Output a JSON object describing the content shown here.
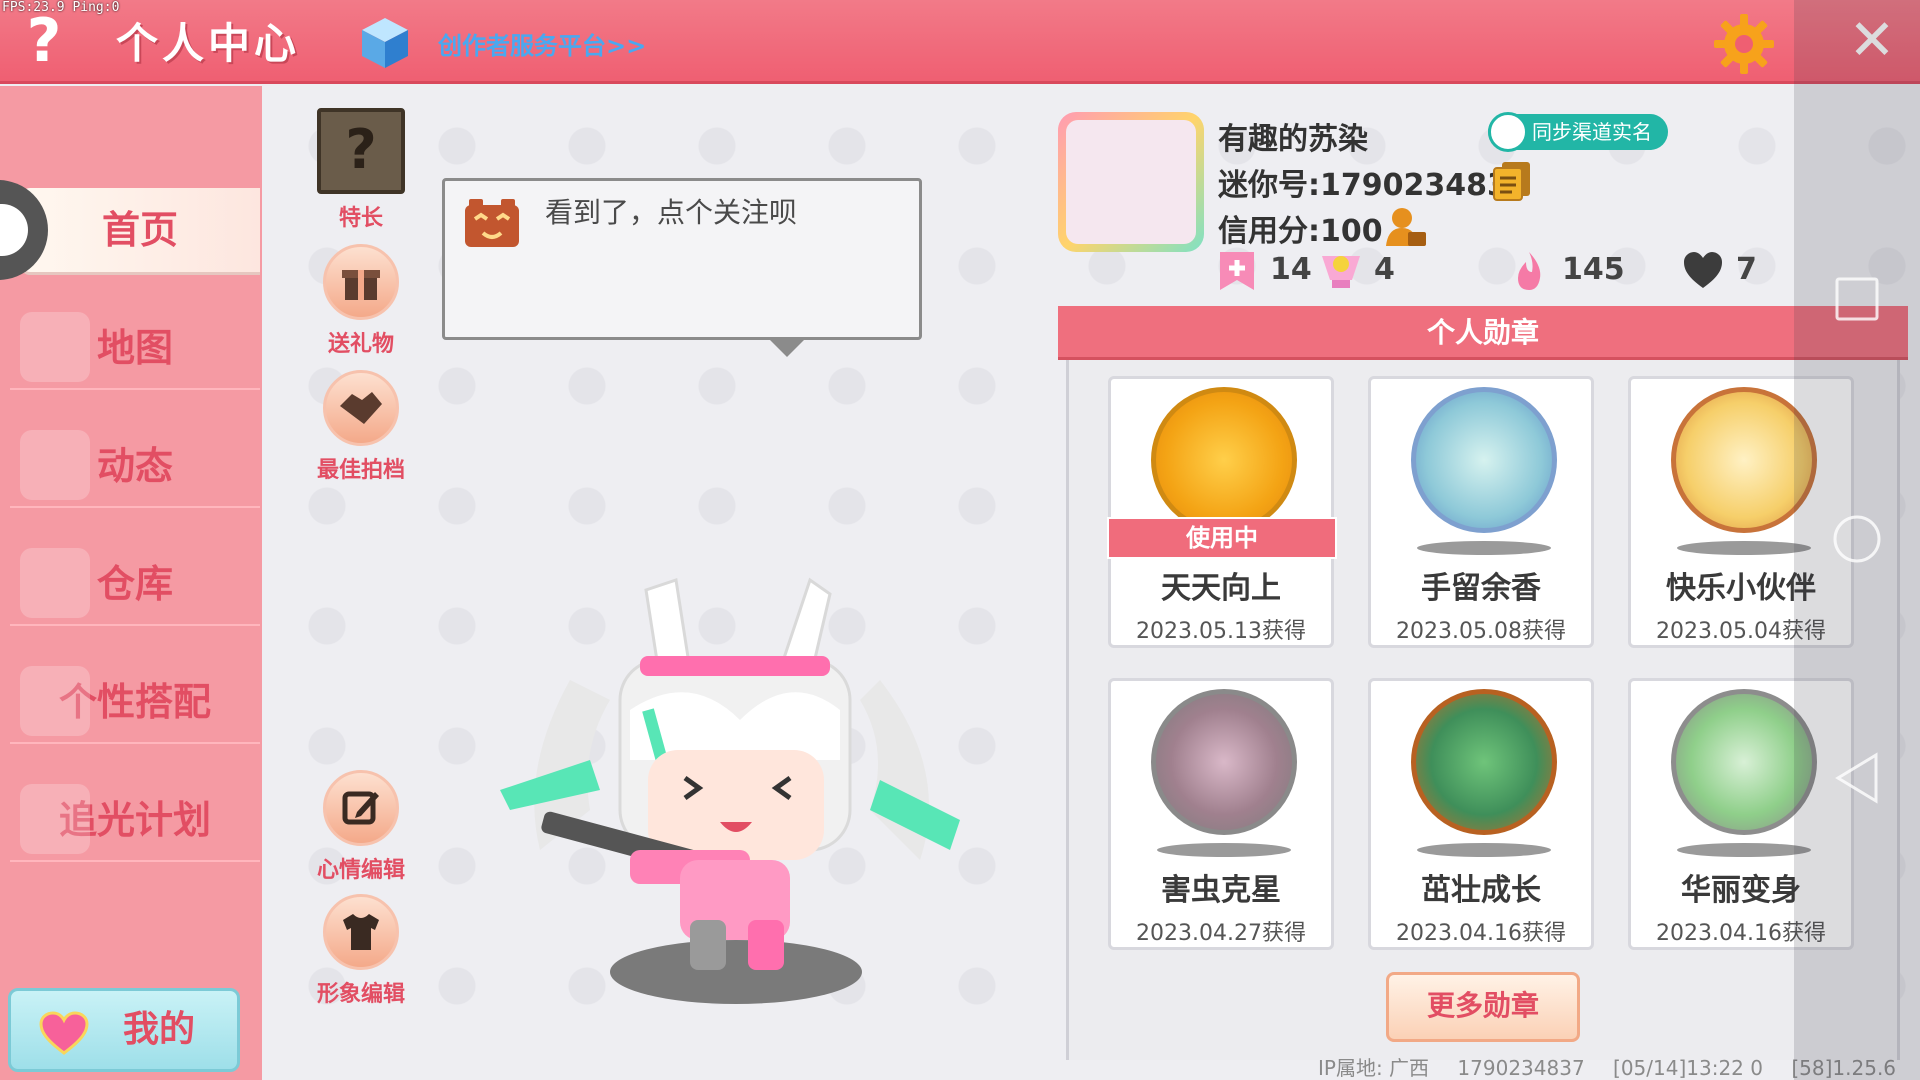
{
  "status": {
    "fps": "FPS:23.9 Ping:0"
  },
  "header": {
    "help": "?",
    "title": "个人中心",
    "creator_link": "创作者服务平台>>",
    "close": "✕"
  },
  "sidebar": {
    "items": [
      {
        "label": "首页",
        "active": true
      },
      {
        "label": "地图"
      },
      {
        "label": "动态"
      },
      {
        "label": "仓库"
      },
      {
        "label": "个性搭配"
      },
      {
        "label": "追光计划"
      }
    ],
    "my_button": "我的"
  },
  "actions": {
    "specialty": {
      "label": "特长",
      "glyph": "?"
    },
    "send_gift": {
      "label": "送礼物"
    },
    "best_partner": {
      "label": "最佳拍档"
    },
    "mood_edit": {
      "label": "心情编辑"
    },
    "image_edit": {
      "label": "形象编辑"
    }
  },
  "bubble": {
    "text": "看到了，点个关注呗"
  },
  "profile": {
    "username": "有趣的苏染",
    "realname_badge": "同步渠道实名",
    "mini_id": "迷你号:1790234837",
    "credit": "信用分:100",
    "stats": {
      "flag": "14",
      "trophy": "4",
      "fire": "145",
      "hearts": "7"
    }
  },
  "medals": {
    "header": "个人勋章",
    "in_use_label": "使用中",
    "items": [
      {
        "name": "天天向上",
        "date": "2023.05.13获得",
        "in_use": true
      },
      {
        "name": "手留余香",
        "date": "2023.05.08获得"
      },
      {
        "name": "快乐小伙伴",
        "date": "2023.05.04获得"
      },
      {
        "name": "害虫克星",
        "date": "2023.04.27获得"
      },
      {
        "name": "茁壮成长",
        "date": "2023.04.16获得"
      },
      {
        "name": "华丽变身",
        "date": "2023.04.16获得"
      }
    ],
    "more_button": "更多勋章"
  },
  "footer": {
    "ip": "IP属地: 广西",
    "uid": "1790234837",
    "timestamp": "[05/14]13:22 0",
    "version": "[58]1.25.6"
  },
  "colors": {
    "header": "#ef5f72",
    "sidebar": "#f59aa3",
    "accent_text": "#e24e63",
    "link": "#4aa8f0",
    "badge": "#22b6a6"
  }
}
